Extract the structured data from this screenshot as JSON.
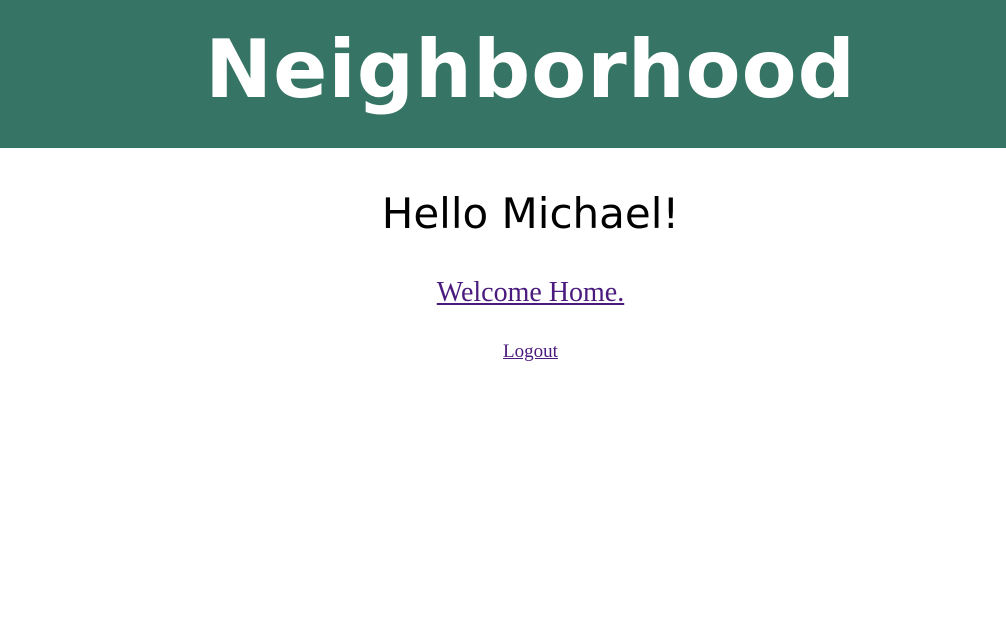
{
  "header": {
    "site_title": "Neighborhood",
    "background_color": "#367565"
  },
  "main": {
    "greeting": "Hello Michael!",
    "welcome_link": "Welcome Home.",
    "logout_link": "Logout",
    "link_color": "#4b1a7e"
  }
}
